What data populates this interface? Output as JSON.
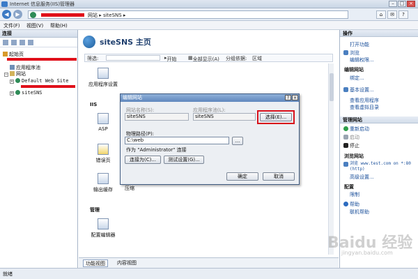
{
  "window": {
    "title": "Internet 信息服务(IIS)管理器",
    "controls": [
      "–",
      "□",
      "×"
    ]
  },
  "address": {
    "crumbs": "网站 ▸ siteSNS ▸",
    "tools": [
      "⌂",
      "✉",
      "?"
    ]
  },
  "menu": {
    "file": "文件(F)",
    "view": "视图(V)",
    "help": "帮助(H)"
  },
  "connections": {
    "header": "连接",
    "tree": {
      "start": "起始页",
      "app_pools": "应用程序池",
      "sites": "网站",
      "default_site": "Default Web Site",
      "site": "siteSNS"
    }
  },
  "center": {
    "title": "siteSNS 主页",
    "filter": {
      "label": "筛选:",
      "start": "开始",
      "show_all": "全部显示(A)",
      "group_by": "分组依据:",
      "group_value": "区域"
    },
    "sections": {
      "iis": "IIS",
      "manage": "管理"
    },
    "features": {
      "app_settings": "应用程序设置",
      "asp": "ASP",
      "error_pages": "错误页",
      "output_cache": "输出缓存",
      "compression": "压缩",
      "config_editor": "配置编辑器"
    },
    "tabs": {
      "features": "功能视图",
      "content": "内容视图"
    }
  },
  "dialog": {
    "title": "编辑网站",
    "site_name_label": "网站名称(S):",
    "site_name_value": "siteSNS",
    "app_pool_label": "应用程序池(L):",
    "app_pool_value": "siteSNS",
    "select_button": "选择(E)...",
    "physical_path_label": "物理路径(P):",
    "physical_path_value": "C:\\web",
    "browse_button": "...",
    "connect_as_note": "作为 \"Administrator\" 连接",
    "connect_as_button": "连接为(C)...",
    "test_settings_button": "测试设置(G)...",
    "ok_button": "确定",
    "cancel_button": "取消",
    "help_glyph": "?",
    "close_glyph": "×"
  },
  "actions": {
    "header": "操作",
    "open_feature": "打开功能",
    "browse": "浏览",
    "edit_permissions": "编辑权限...",
    "edit_site_header": "编辑网站",
    "bindings": "绑定...",
    "basic_settings": "基本设置...",
    "view_apps": "查看应用程序",
    "view_vdirs": "查看虚拟目录",
    "manage_site_header": "管理网站",
    "restart": "重新启动",
    "start": "启动",
    "stop": "停止",
    "browse_site_header": "浏览网站",
    "browse_url": "浏览 www.test.com on *:80 (http)",
    "advanced": "高级设置...",
    "config_header": "配置",
    "limits": "限制",
    "help": "帮助",
    "online_help": "联机帮助"
  },
  "status": {
    "text": "就绪"
  },
  "watermark": {
    "main": "Baidu 经验",
    "sub": "jingyan.baidu.com"
  },
  "colors": {
    "accent": "#1f5f9c",
    "highlight": "#d8101b",
    "link": "#1a4f9a"
  }
}
